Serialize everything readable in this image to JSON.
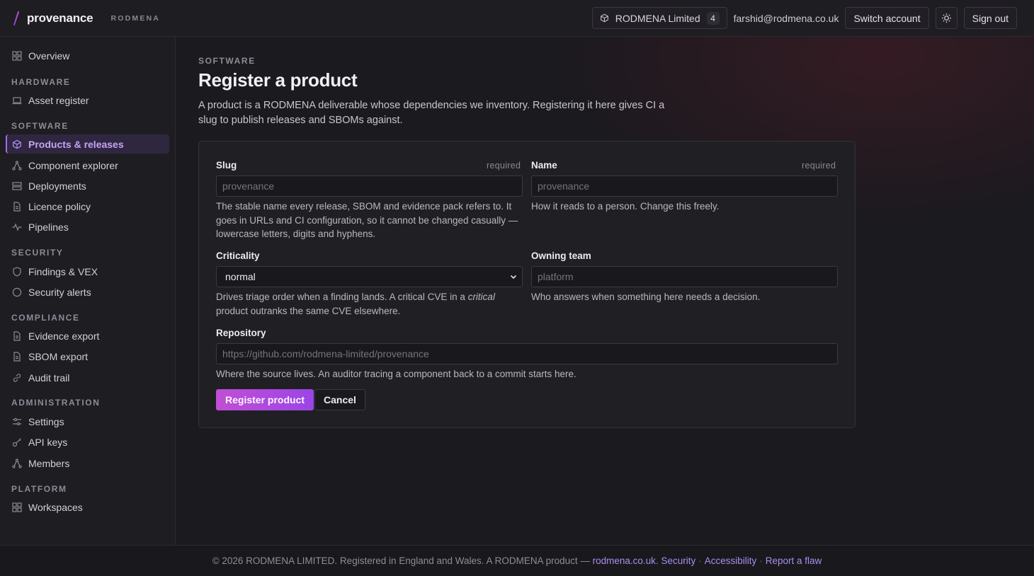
{
  "brand": {
    "name": "provenance",
    "org": "RODMENA"
  },
  "header": {
    "org_name": "RODMENA Limited",
    "org_count": "4",
    "user_email": "farshid@rodmena.co.uk",
    "switch_account": "Switch account",
    "sign_out": "Sign out"
  },
  "sidebar": {
    "overview": "Overview",
    "sections": [
      {
        "heading": "HARDWARE",
        "items": [
          "Asset register"
        ]
      },
      {
        "heading": "SOFTWARE",
        "items": [
          "Products & releases",
          "Component explorer",
          "Deployments",
          "Licence policy",
          "Pipelines"
        ]
      },
      {
        "heading": "SECURITY",
        "items": [
          "Findings & VEX",
          "Security alerts"
        ]
      },
      {
        "heading": "COMPLIANCE",
        "items": [
          "Evidence export",
          "SBOM export",
          "Audit trail"
        ]
      },
      {
        "heading": "ADMINISTRATION",
        "items": [
          "Settings",
          "API keys",
          "Members"
        ]
      },
      {
        "heading": "PLATFORM",
        "items": [
          "Workspaces"
        ]
      }
    ],
    "active": "Products & releases"
  },
  "page": {
    "eyebrow": "SOFTWARE",
    "title": "Register a product",
    "lead": "A product is a RODMENA deliverable whose dependencies we inventory. Registering it here gives CI a slug to publish releases and SBOMs against."
  },
  "form": {
    "slug": {
      "label": "Slug",
      "required": "required",
      "placeholder": "provenance",
      "help": "The stable name every release, SBOM and evidence pack refers to. It goes in URLs and CI configuration, so it cannot be changed casually — lowercase letters, digits and hyphens."
    },
    "name": {
      "label": "Name",
      "required": "required",
      "placeholder": "provenance",
      "help": "How it reads to a person. Change this freely."
    },
    "criticality": {
      "label": "Criticality",
      "value": "normal",
      "help_before": "Drives triage order when a finding lands. A critical CVE in a ",
      "help_em": "critical",
      "help_after": " product outranks the same CVE elsewhere."
    },
    "owning_team": {
      "label": "Owning team",
      "placeholder": "platform",
      "help": "Who answers when something here needs a decision."
    },
    "repository": {
      "label": "Repository",
      "placeholder": "https://github.com/rodmena-limited/provenance",
      "help": "Where the source lives. An auditor tracing a component back to a commit starts here."
    },
    "submit": "Register product",
    "cancel": "Cancel"
  },
  "footer": {
    "text": "© 2026 RODMENA LIMITED. Registered in England and Wales. A RODMENA product —",
    "link_site": "rodmena.co.uk",
    "link_security": "Security",
    "link_accessibility": "Accessibility",
    "link_report": "Report a flaw"
  },
  "colors": {
    "accent": "#a46bf0",
    "primary_button": "#c24ed4",
    "link": "#a98ef0"
  }
}
